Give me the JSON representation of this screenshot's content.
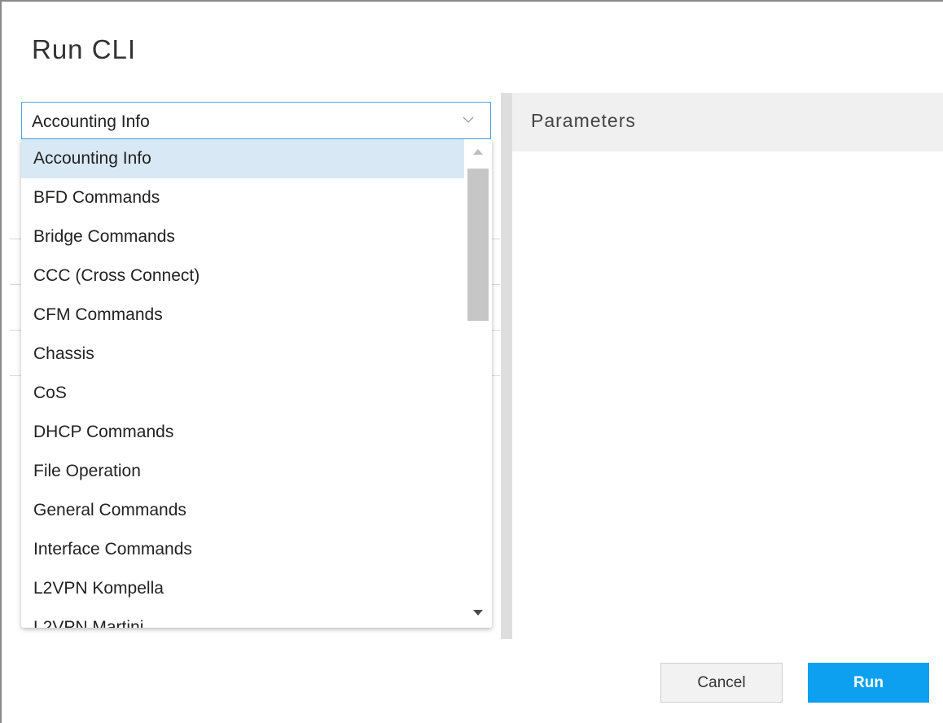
{
  "dialog": {
    "title": "Run CLI"
  },
  "command_select": {
    "selected_value": "Accounting Info",
    "options": [
      "Accounting Info",
      "BFD Commands",
      "Bridge Commands",
      "CCC (Cross Connect)",
      "CFM Commands",
      "Chassis",
      "CoS",
      "DHCP Commands",
      "File Operation",
      "General Commands",
      "Interface Commands",
      "L2VPN Kompella",
      "L2VPN Martini"
    ]
  },
  "parameters": {
    "header": "Parameters"
  },
  "footer": {
    "cancel_label": "Cancel",
    "run_label": "Run"
  },
  "colors": {
    "accent": "#0ea0f0",
    "selected_option_bg": "#d9e8f5",
    "select_border": "#4aa3e8"
  },
  "icons": {
    "select_chevron": "chevron-down-icon",
    "scroll_up": "scroll-up-arrow-icon",
    "scroll_down": "scroll-down-arrow-icon"
  }
}
